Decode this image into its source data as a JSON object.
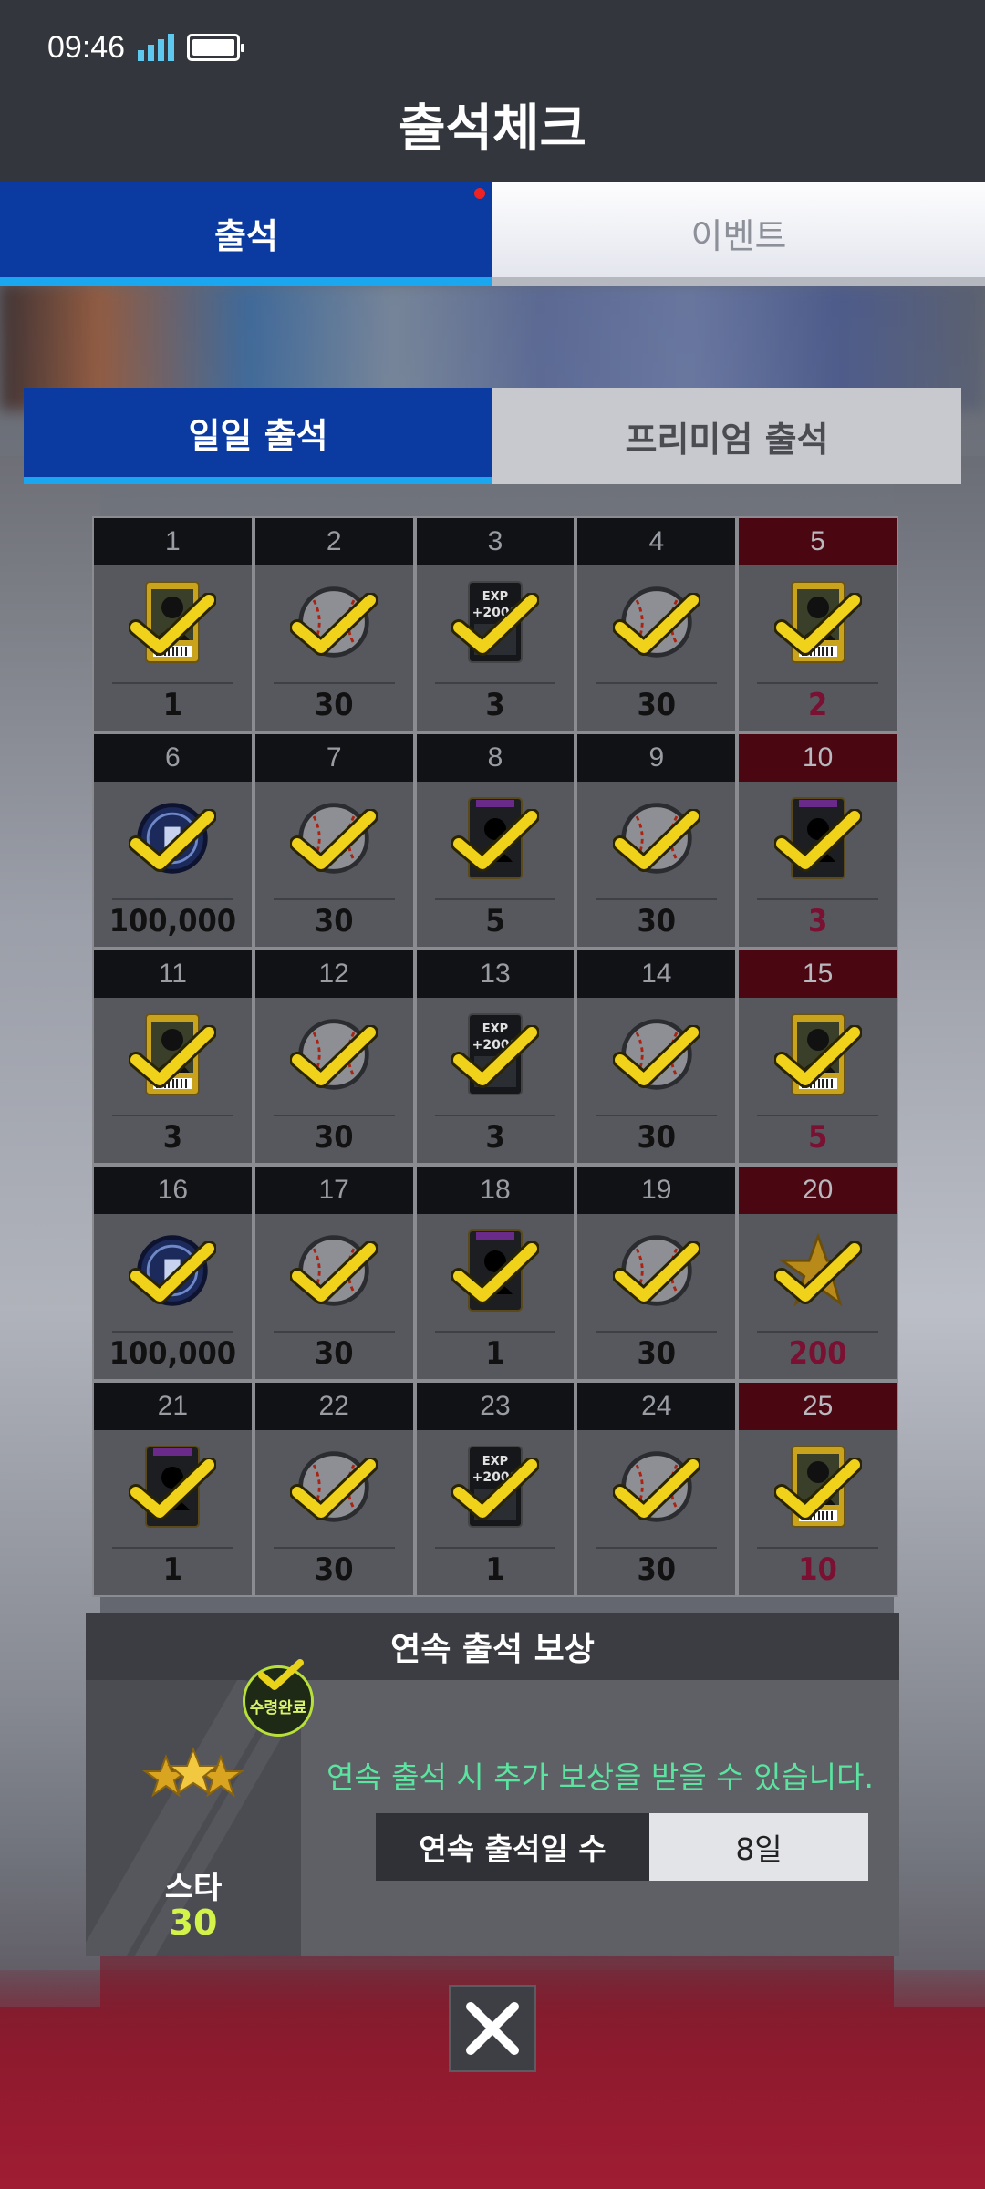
{
  "status_bar": {
    "time": "09:46"
  },
  "header": {
    "title": "출석체크"
  },
  "main_tabs": [
    {
      "label": "출석",
      "active": true
    },
    {
      "label": "이벤트",
      "active": false
    }
  ],
  "sub_tabs": [
    {
      "label": "일일 출석",
      "active": true
    },
    {
      "label": "프리미엄 출석",
      "active": false
    }
  ],
  "days": [
    {
      "day": "1",
      "value": "1",
      "reward_icon": "player-card-icon",
      "claimed": true
    },
    {
      "day": "2",
      "value": "30",
      "reward_icon": "baseball-icon",
      "claimed": true
    },
    {
      "day": "3",
      "value": "3",
      "reward_icon": "exp-card-icon",
      "claimed": true
    },
    {
      "day": "4",
      "value": "30",
      "reward_icon": "baseball-icon",
      "claimed": true
    },
    {
      "day": "5",
      "value": "2",
      "reward_icon": "player-card-icon",
      "claimed": true
    },
    {
      "day": "6",
      "value": "100,000",
      "reward_icon": "coin-icon",
      "claimed": true
    },
    {
      "day": "7",
      "value": "30",
      "reward_icon": "baseball-icon",
      "claimed": true
    },
    {
      "day": "8",
      "value": "5",
      "reward_icon": "dark-card-icon",
      "claimed": true
    },
    {
      "day": "9",
      "value": "30",
      "reward_icon": "baseball-icon",
      "claimed": true
    },
    {
      "day": "10",
      "value": "3",
      "reward_icon": "dark-card-icon",
      "claimed": true
    },
    {
      "day": "11",
      "value": "3",
      "reward_icon": "player-card-icon",
      "claimed": true
    },
    {
      "day": "12",
      "value": "30",
      "reward_icon": "baseball-icon",
      "claimed": true
    },
    {
      "day": "13",
      "value": "3",
      "reward_icon": "exp-card-icon",
      "claimed": true
    },
    {
      "day": "14",
      "value": "30",
      "reward_icon": "baseball-icon",
      "claimed": true
    },
    {
      "day": "15",
      "value": "5",
      "reward_icon": "player-card-icon",
      "claimed": true
    },
    {
      "day": "16",
      "value": "100,000",
      "reward_icon": "coin-icon",
      "claimed": true
    },
    {
      "day": "17",
      "value": "30",
      "reward_icon": "baseball-icon",
      "claimed": true
    },
    {
      "day": "18",
      "value": "1",
      "reward_icon": "dark-card-icon",
      "claimed": true
    },
    {
      "day": "19",
      "value": "30",
      "reward_icon": "baseball-icon",
      "claimed": true
    },
    {
      "day": "20",
      "value": "200",
      "reward_icon": "star-icon",
      "claimed": true
    },
    {
      "day": "21",
      "value": "1",
      "reward_icon": "dark-card-icon",
      "claimed": true
    },
    {
      "day": "22",
      "value": "30",
      "reward_icon": "baseball-icon",
      "claimed": true
    },
    {
      "day": "23",
      "value": "1",
      "reward_icon": "exp-card-icon",
      "claimed": true
    },
    {
      "day": "24",
      "value": "30",
      "reward_icon": "baseball-icon",
      "claimed": true
    },
    {
      "day": "25",
      "value": "10",
      "reward_icon": "player-card-icon",
      "claimed": true
    }
  ],
  "streak": {
    "title": "연속 출석 보상",
    "reward_label": "스타",
    "reward_count": "30",
    "badge_text": "수령완료",
    "message": "연속 출석 시 추가 보상을 받을 수 있습니다.",
    "days_label": "연속 출석일 수",
    "days_value": "8일"
  },
  "colors": {
    "tab_active": "#0b3aa0",
    "tab_accent": "#1aa7ef",
    "check": "#f0d21a",
    "streak_message": "#5be3a0",
    "star_count": "#d3f24a"
  }
}
